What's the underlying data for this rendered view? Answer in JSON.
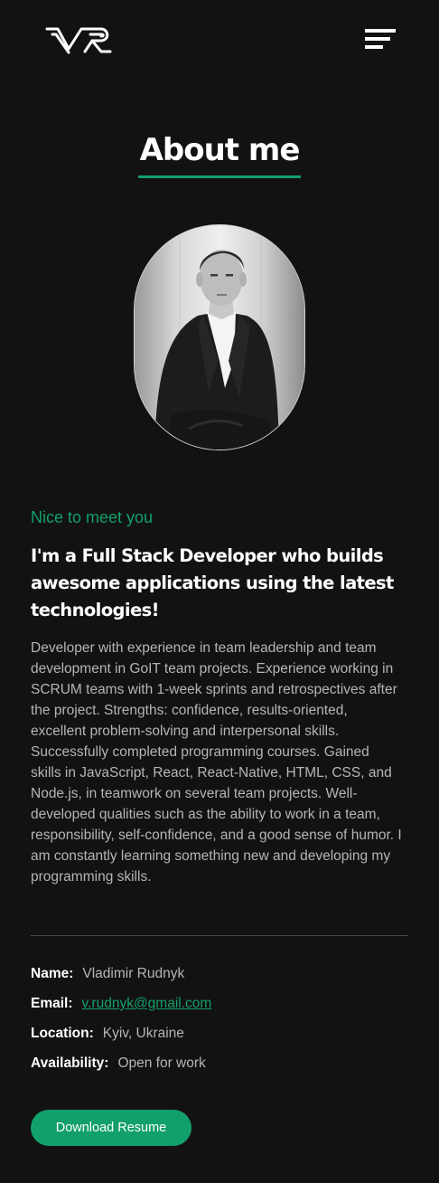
{
  "header": {
    "logo_text": "VR",
    "menu_icon": "hamburger-menu-icon"
  },
  "about": {
    "title": "About me",
    "portrait_icon": "profile-photo"
  },
  "intro": {
    "greeting": "Nice to meet you",
    "headline": "I'm a Full Stack Developer who builds awesome applications using the latest technologies!",
    "bio": "Developer with experience in team leadership and team development in GoIT team projects. Experience working in SCRUM teams with 1-week sprints and retrospectives after the project. Strengths: confidence, results-oriented, excellent problem-solving and interpersonal skills. Successfully completed programming courses. Gained skills in JavaScript, React, React-Native, HTML, CSS, and Node.js, in teamwork on several team projects. Well-developed qualities such as the ability to work in a team, responsibility, self-confidence, and a good sense of humor. I am constantly learning something new and developing my programming skills."
  },
  "info": {
    "name_label": "Name:",
    "name_value": "Vladimir Rudnyk",
    "email_label": "Email:",
    "email_value": "v.rudnyk@gmail.com",
    "location_label": "Location:",
    "location_value": "Kyiv, Ukraine",
    "availability_label": "Availability:",
    "availability_value": "Open for work"
  },
  "actions": {
    "download_label": "Download Resume"
  },
  "colors": {
    "background": "#121212",
    "accent": "#12a06a",
    "text": "#ffffff",
    "muted_text": "#b5b5b5"
  }
}
